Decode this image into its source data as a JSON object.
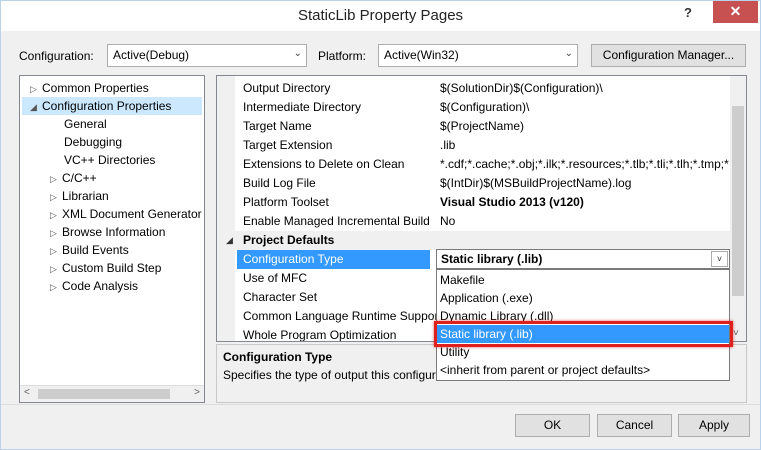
{
  "window": {
    "title": "StaticLib Property Pages",
    "help_glyph": "?",
    "close_glyph": "✕"
  },
  "toolbar": {
    "configuration_label": "Configuration:",
    "configuration_value": "Active(Debug)",
    "platform_label": "Platform:",
    "platform_value": "Active(Win32)",
    "config_manager_label": "Configuration Manager..."
  },
  "tree": {
    "items": [
      {
        "label": "Common Properties",
        "expander": "▷"
      },
      {
        "label": "Configuration Properties",
        "expander": "◢"
      },
      {
        "label": "General",
        "expander": ""
      },
      {
        "label": "Debugging",
        "expander": ""
      },
      {
        "label": "VC++ Directories",
        "expander": ""
      },
      {
        "label": "C/C++",
        "expander": "▷"
      },
      {
        "label": "Librarian",
        "expander": "▷"
      },
      {
        "label": "XML Document Generator",
        "expander": "▷"
      },
      {
        "label": "Browse Information",
        "expander": "▷"
      },
      {
        "label": "Build Events",
        "expander": "▷"
      },
      {
        "label": "Custom Build Step",
        "expander": "▷"
      },
      {
        "label": "Code Analysis",
        "expander": "▷"
      }
    ],
    "scroll_left": "<",
    "scroll_right": ">"
  },
  "grid": {
    "rows": [
      {
        "name": "Output Directory",
        "value": "$(SolutionDir)$(Configuration)\\"
      },
      {
        "name": "Intermediate Directory",
        "value": "$(Configuration)\\"
      },
      {
        "name": "Target Name",
        "value": "$(ProjectName)"
      },
      {
        "name": "Target Extension",
        "value": ".lib"
      },
      {
        "name": "Extensions to Delete on Clean",
        "value": "*.cdf;*.cache;*.obj;*.ilk;*.resources;*.tlb;*.tli;*.tlh;*.tmp;*"
      },
      {
        "name": "Build Log File",
        "value": "$(IntDir)$(MSBuildProjectName).log"
      },
      {
        "name": "Platform Toolset",
        "value": "Visual Studio 2013 (v120)"
      },
      {
        "name": "Enable Managed Incremental Build",
        "value": "No"
      }
    ],
    "category": {
      "label": "Project Defaults",
      "expander": "◢"
    },
    "rows2": [
      {
        "name": "Configuration Type",
        "value": "Static library (.lib)"
      },
      {
        "name": "Use of MFC",
        "value": ""
      },
      {
        "name": "Character Set",
        "value": ""
      },
      {
        "name": "Common Language Runtime Support",
        "value": ""
      },
      {
        "name": "Whole Program Optimization",
        "value": ""
      }
    ],
    "scroll_down": "˅"
  },
  "dropdown": {
    "selected": "Static library (.lib)",
    "arrow": "˅",
    "options": [
      "Makefile",
      "Application (.exe)",
      "Dynamic Library (.dll)",
      "Static library (.lib)",
      "Utility",
      "<inherit from parent or project defaults>"
    ]
  },
  "description": {
    "title": "Configuration Type",
    "text": "Specifies the type of output this configuration generates."
  },
  "footer": {
    "ok": "OK",
    "cancel": "Cancel",
    "apply": "Apply"
  }
}
